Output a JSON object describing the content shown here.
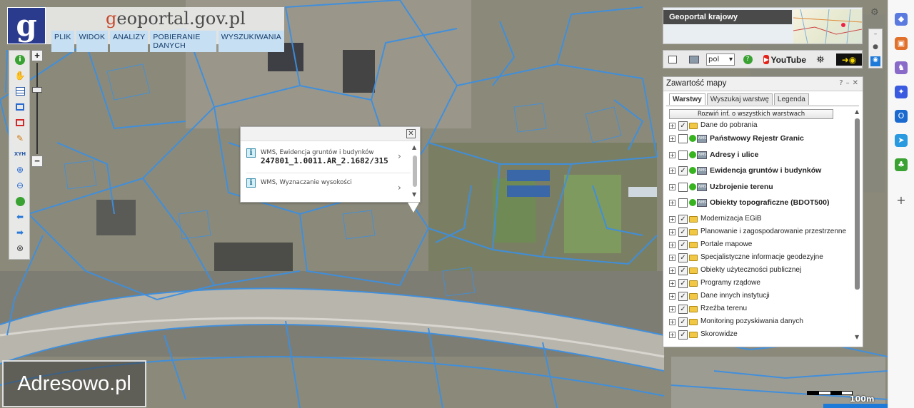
{
  "brand": {
    "logo_letter": "g",
    "title_prefix": "g",
    "title_rest": "eoportal.gov.pl"
  },
  "menu": [
    "PLIK",
    "WIDOK",
    "ANALIZY",
    "POBIERANIE DANYCH",
    "WYSZUKIWANIA"
  ],
  "toolbar": {
    "tools": [
      "info-icon",
      "hand-pan-icon",
      "table-icon",
      "select-icon",
      "erase-select-icon",
      "pencil-icon",
      "xyh-icon",
      "zoom-in-icon",
      "zoom-out-icon",
      "globe-icon",
      "back-arrow-icon",
      "forward-arrow-icon",
      "cross-circle-icon"
    ],
    "xyh_label": "XYH",
    "zoom_plus": "+",
    "zoom_minus": "−"
  },
  "popup": {
    "close": "✕",
    "rows": [
      {
        "label": "WMS, Ewidencja gruntów i budynków",
        "value": "247801_1.0011.AR_2.1682/315"
      },
      {
        "label": "WMS, Wyznaczanie wysokości",
        "value": ""
      }
    ],
    "chevron": "›"
  },
  "watermark": "Adresowo.pl",
  "scale": {
    "label": "100m"
  },
  "overview": {
    "title": "Geoportal krajowy"
  },
  "icon_bar": {
    "language": "pol",
    "youtube": "YouTube",
    "help": "?"
  },
  "panel": {
    "title": "Zawartość mapy",
    "controls": [
      "?",
      "–",
      "✕"
    ],
    "tabs": [
      "Warstwy",
      "Wyszukaj warstwę",
      "Legenda"
    ],
    "expand_all": "Rozwiń inf. o wszystkich warstwach",
    "layers": [
      {
        "name": "Dane do pobrania",
        "checked": true,
        "kind": "folder"
      },
      {
        "name": "Państwowy Rejestr Granic",
        "checked": false,
        "kind": "wms"
      },
      {
        "name": "Adresy i ulice",
        "checked": false,
        "kind": "wms"
      },
      {
        "name": "Ewidencja gruntów i budynków",
        "checked": true,
        "kind": "wms"
      },
      {
        "name": "Uzbrojenie terenu",
        "checked": false,
        "kind": "wms"
      },
      {
        "name": "Obiekty topograficzne (BDOT500)",
        "checked": false,
        "kind": "wms"
      },
      {
        "name": "Modernizacja EGiB",
        "checked": true,
        "kind": "folder"
      },
      {
        "name": "Planowanie i zagospodarowanie przestrzenne",
        "checked": true,
        "kind": "folder"
      },
      {
        "name": "Portale mapowe",
        "checked": true,
        "kind": "folder"
      },
      {
        "name": "Specjalistyczne informacje geodezyjne",
        "checked": true,
        "kind": "folder"
      },
      {
        "name": "Obiekty użyteczności publicznej",
        "checked": true,
        "kind": "folder"
      },
      {
        "name": "Programy rządowe",
        "checked": true,
        "kind": "folder"
      },
      {
        "name": "Dane innych instytucji",
        "checked": true,
        "kind": "folder"
      },
      {
        "name": "Rzeźba terenu",
        "checked": true,
        "kind": "folder"
      },
      {
        "name": "Monitoring pozyskiwania danych",
        "checked": true,
        "kind": "folder"
      },
      {
        "name": "Skorowidze",
        "checked": true,
        "kind": "folder"
      }
    ]
  },
  "colors": {
    "parcel_line": "#3d8fe0",
    "brand_blue": "#2a3a8c",
    "menu_bg": "#c6dff2",
    "accent": "#1d7ad8"
  }
}
